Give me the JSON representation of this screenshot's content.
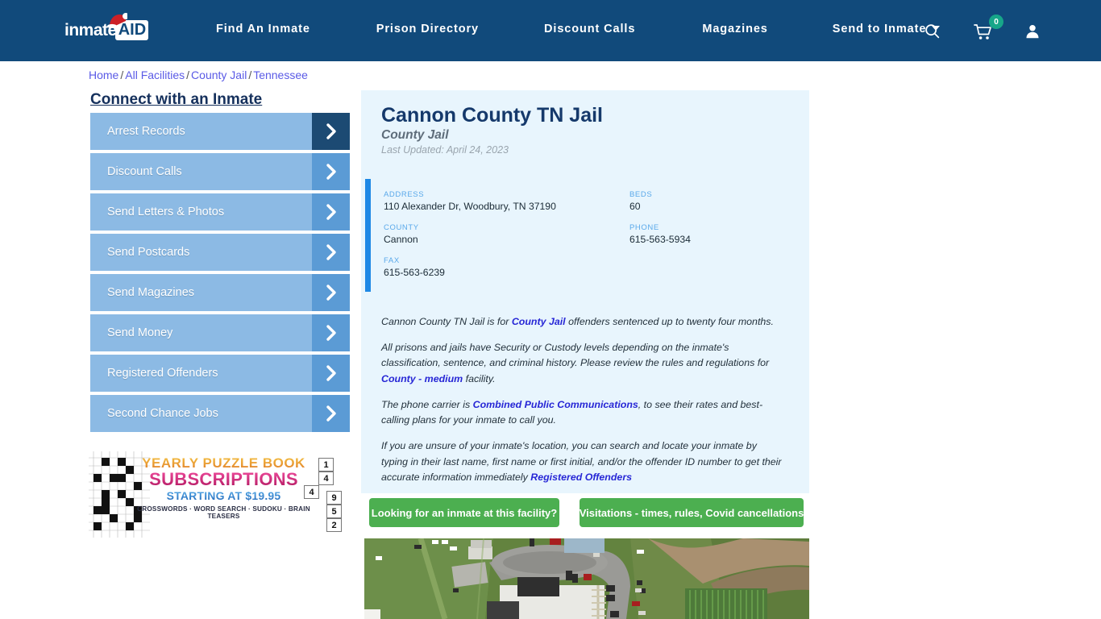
{
  "navbar": {
    "logo": {
      "text_1": "inmate",
      "text_2": "AID",
      "icon": "santa-hat-icon"
    },
    "links": [
      {
        "label": "Find An Inmate"
      },
      {
        "label": "Prison Directory"
      },
      {
        "label": "Discount Calls"
      },
      {
        "label": "Magazines"
      },
      {
        "label": "Send to Inmate"
      }
    ],
    "icons": {
      "search": "search-icon",
      "cart": "shopping-cart-icon",
      "cart_count": "0",
      "account": "user-account-icon"
    },
    "bg_color": "#114a7b"
  },
  "breadcrumb": {
    "items": [
      "Home",
      "All Facilities",
      "County Jail",
      "Tennessee"
    ],
    "separator": "/"
  },
  "sidebar": {
    "title": "Connect with an Inmate",
    "items": [
      {
        "label": "Arrest Records"
      },
      {
        "label": "Discount Calls"
      },
      {
        "label": "Send Letters & Photos"
      },
      {
        "label": "Send Postcards"
      },
      {
        "label": "Send Magazines"
      },
      {
        "label": "Send Money"
      },
      {
        "label": "Registered Offenders"
      },
      {
        "label": "Second Chance Jobs"
      }
    ],
    "button_color": "#8cbae4",
    "arrow_color": "#5b9bd5",
    "arrow_color_active": "#1c4a73"
  },
  "ad": {
    "line1": "YEARLY PUZZLE BOOK",
    "line2": "SUBSCRIPTIONS",
    "line3": "STARTING AT $19.95",
    "line4": "CROSSWORDS · WORD SEARCH · SUDOKU · BRAIN TEASERS",
    "sudoku_digits": [
      "1",
      "4",
      "4",
      "9",
      "5",
      "2"
    ]
  },
  "facility": {
    "title": "Cannon County TN Jail",
    "subtitle": "County Jail",
    "last_updated": "Last Updated: April 24, 2023",
    "info": {
      "address_label": "ADDRESS",
      "address_value": "110 Alexander Dr, Woodbury, TN 37190",
      "county_label": "COUNTY",
      "county_value": "Cannon",
      "fax_label": "FAX",
      "fax_value": "615-563-6239",
      "beds_label": "BEDS",
      "beds_value": "60",
      "phone_label": "PHONE",
      "phone_value": "615-563-5934"
    },
    "description": {
      "p1_a": "Cannon County TN Jail is for ",
      "p1_link": "County Jail",
      "p1_b": " offenders sentenced up to twenty four months.",
      "p2_a": "All prisons and jails have Security or Custody levels depending on the inmate's classification, sentence, and criminal history. Please review the rules and regulations for ",
      "p2_link": "County - medium",
      "p2_b": " facility.",
      "p3_a": "The phone carrier is ",
      "p3_link": "Combined Public Communications",
      "p3_b": ", to see their rates and best-calling plans for your inmate to call you.",
      "p4_a": "If you are unsure of your inmate's location, you can search and locate your inmate by typing in their last name, first name or first initial, and/or the offender ID number to get their accurate information immediately ",
      "p4_link": "Registered Offenders"
    },
    "panel_bg": "#e8f5fd",
    "accent_color": "#1e88e5"
  },
  "cta": {
    "button_1": "Looking for an inmate at this facility?",
    "button_2": "Visitations - times, rules, Covid cancellations",
    "color": "#4caf50"
  },
  "map": {
    "name": "satellite-aerial-view-of-facility"
  }
}
